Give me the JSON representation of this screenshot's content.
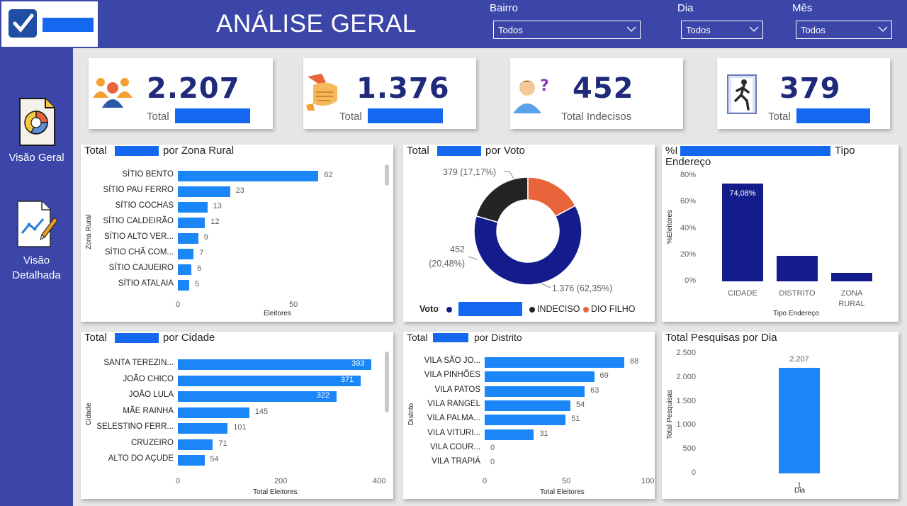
{
  "header": {
    "title": "ANÁLISE GERAL",
    "filters": [
      {
        "label": "Bairro",
        "value": "Todos"
      },
      {
        "label": "Dia",
        "value": "Todos"
      },
      {
        "label": "Mês",
        "value": "Todos"
      }
    ]
  },
  "sidebar": {
    "items": [
      {
        "label": "Visão Geral",
        "icon": "pie-chart-document-icon"
      },
      {
        "label": "Visão Detalhada",
        "icon": "line-chart-document-icon"
      }
    ]
  },
  "kpis": [
    {
      "value": "2.207",
      "label": "Total",
      "icon": "people-group-icon"
    },
    {
      "value": "1.376",
      "label": "Total",
      "icon": "handshake-icon"
    },
    {
      "value": "452",
      "label": "Total Indecisos",
      "icon": "person-question-icon"
    },
    {
      "value": "379",
      "label": "Total",
      "icon": "exit-door-icon"
    }
  ],
  "panels": {
    "zona_rural": {
      "title_a": "Total",
      "title_b": "por Zona Rural"
    },
    "voto": {
      "title_a": "Total",
      "title_b": "por Voto"
    },
    "tipo": {
      "title_a": "%I",
      "title_b": "Tipo",
      "title_c": "Endereço"
    },
    "cidade": {
      "title_a": "Total",
      "title_b": "por Cidade"
    },
    "distrito": {
      "title_a": "Total",
      "title_b": "por Distrito"
    },
    "dia": {
      "title": "Total Pesquisas por Dia"
    }
  },
  "chart_data": [
    {
      "type": "bar",
      "orientation": "horizontal",
      "ylabel": "Zona Rural",
      "xlabel": "Eleitores",
      "categories": [
        "SÍTIO BENTO",
        "SÍTIO PAU FERRO",
        "SÍTIO COCHAS",
        "SÍTIO CALDEIRÃO",
        "SÍTIO ALTO VER...",
        "SÍTIO CHÃ COM...",
        "SÍTIO CAJUEIRO",
        "SÍTIO ATALAIA"
      ],
      "values": [
        62,
        23,
        13,
        12,
        9,
        7,
        6,
        5
      ],
      "xticks": [
        "0",
        "50"
      ],
      "xlim": [
        0,
        75
      ]
    },
    {
      "type": "pie",
      "donut": true,
      "legend_title": "Voto",
      "legend": [
        "",
        "INDECISO",
        "DIO FILHO"
      ],
      "slices": [
        {
          "value": 1376,
          "pct": 62.35,
          "label": "1.376 (62,35%)",
          "color": "#141c8c"
        },
        {
          "value": 452,
          "pct": 20.48,
          "label_a": "452",
          "label_b": "(20,48%)",
          "color": "#252423"
        },
        {
          "value": 379,
          "pct": 17.17,
          "label": "379 (17,17%)",
          "color": "#e8643a"
        }
      ]
    },
    {
      "type": "bar",
      "ylabel": "%Eleitores",
      "xlabel": "Tipo Endereço",
      "categories": [
        "CIDADE",
        "DISTRITO",
        "ZONA RURAL"
      ],
      "values": [
        74.08,
        19.35,
        6.57
      ],
      "value_labels": [
        "74,08%",
        "19,35%",
        "6,57%"
      ],
      "yticks": [
        "80%",
        "60%",
        "40%",
        "20%",
        "0%"
      ],
      "ylim": [
        0,
        80
      ]
    },
    {
      "type": "bar",
      "orientation": "horizontal",
      "ylabel": "Cidade",
      "xlabel": "Total Eleitores",
      "categories": [
        "SANTA TEREZIN...",
        "JOÃO CHICO",
        "JOÃO LULA",
        "MÃE RAINHA",
        "SELESTINO FERR...",
        "CRUZEIRO",
        "ALTO DO AÇUDE"
      ],
      "values": [
        393,
        371,
        322,
        145,
        101,
        71,
        54
      ],
      "xticks": [
        "0",
        "200",
        "400"
      ],
      "xlim": [
        0,
        400
      ]
    },
    {
      "type": "bar",
      "orientation": "horizontal",
      "ylabel": "Distrito",
      "xlabel": "Total Eleitores",
      "categories": [
        "VILA SÃO JO...",
        "VILA PINHÕES",
        "VILA PATOS",
        "VILA RANGEL",
        "VILA PALMA...",
        "VILA VITURI...",
        "VILA COUR...",
        "VILA TRAPIÁ"
      ],
      "values": [
        88,
        69,
        63,
        54,
        51,
        31,
        0,
        0
      ],
      "xticks": [
        "0",
        "50",
        "100"
      ],
      "xlim": [
        0,
        100
      ]
    },
    {
      "type": "bar",
      "ylabel": "Total Pesquisas",
      "xlabel": "Dia",
      "categories": [
        "1"
      ],
      "values": [
        2207
      ],
      "value_labels": [
        "2.207"
      ],
      "yticks": [
        "2.500",
        "2.000",
        "1.500",
        "1.000",
        "500",
        "0"
      ],
      "ylim": [
        0,
        2500
      ]
    }
  ]
}
